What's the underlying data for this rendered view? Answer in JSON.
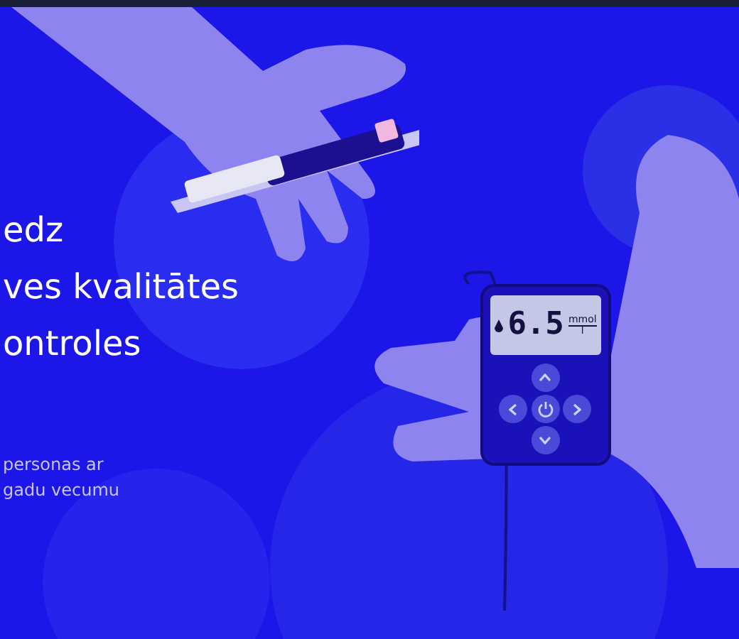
{
  "hero": {
    "heading_lines": [
      "edz",
      "ves kvalitātes",
      "ontroles"
    ],
    "subtitle_lines": [
      "personas ar",
      "gadu vecumu"
    ]
  },
  "device": {
    "reading": "6.5",
    "unit_top": "mmol",
    "unit_bottom": "l"
  }
}
